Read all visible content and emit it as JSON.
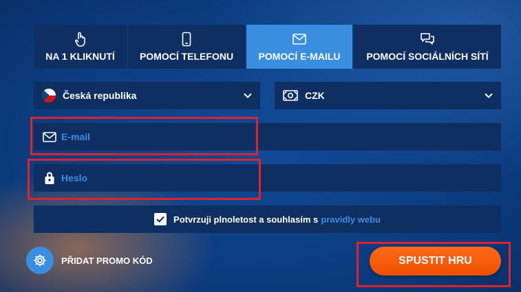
{
  "tabs": [
    {
      "label": "NA 1 KLIKNUTÍ",
      "icon": "pointer-hand-icon"
    },
    {
      "label": "POMOCÍ TELEFONU",
      "icon": "phone-icon"
    },
    {
      "label": "POMOCÍ E-MAILU",
      "icon": "envelope-icon",
      "active": true
    },
    {
      "label": "POMOCÍ SOCIÁLNÍCH SÍTÍ",
      "icon": "chat-bubbles-icon"
    }
  ],
  "country_select": {
    "value": "Česká republika",
    "icon": "czech-flag-icon"
  },
  "currency_select": {
    "value": "CZK",
    "icon": "money-icon"
  },
  "email_field": {
    "placeholder": "E-mail",
    "icon": "envelope-icon"
  },
  "password_field": {
    "placeholder": "Heslo",
    "icon": "lock-icon"
  },
  "consent": {
    "checked": true,
    "text": "Potvrzuji plnoletost a souhlasím s",
    "link_text": "pravidly webu"
  },
  "promo": {
    "label": "PŘIDAT PROMO KÓD",
    "icon": "gear-icon"
  },
  "start_button": {
    "label": "SPUSTIT HRU"
  },
  "colors": {
    "accent": "#3a8ee0",
    "panel": "#0f2f63",
    "highlight": "#e0232b",
    "button": "#ff6a1a"
  }
}
